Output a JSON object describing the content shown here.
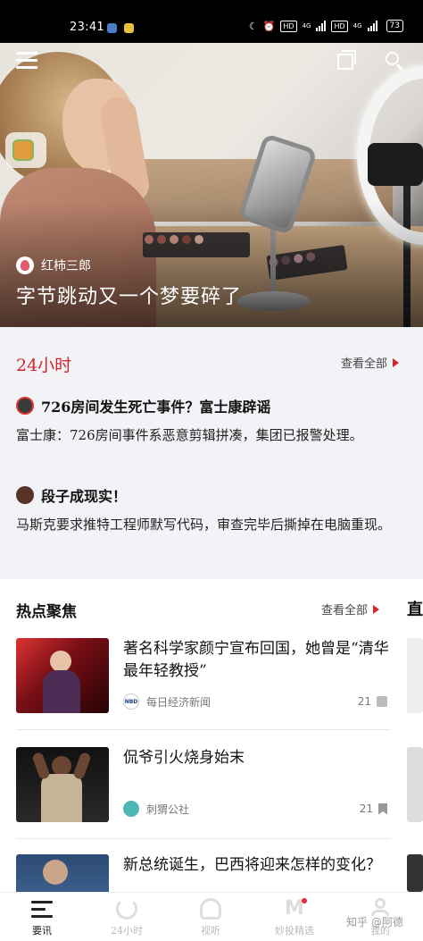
{
  "status_bar": {
    "time": "23:41",
    "network_labels": [
      "4G",
      "4G"
    ],
    "hd_labels": [
      "HD",
      "HD"
    ],
    "battery": "73"
  },
  "hero": {
    "author": "红柿三郎",
    "title": "字节跳动又一个梦要碎了"
  },
  "section_24h": {
    "title": "24小时",
    "see_all": "查看全部",
    "items": [
      {
        "headline": "726房间发生死亡事件？富士康辟谣",
        "summary": "富士康：726房间事件系恶意剪辑拼凑，集团已报警处理。"
      },
      {
        "headline": "段子成现实！",
        "summary": "马斯克要求推特工程师默写代码，审查完毕后撕掉在电脑重现。"
      }
    ]
  },
  "hot_focus": {
    "title": "热点聚焦",
    "see_all": "查看全部",
    "side_tab": "直",
    "items": [
      {
        "title": "著名科学家颜宁宣布回国，她曾是“清华最年轻教授”",
        "source": "每日经济新闻",
        "source_logo": "NBD",
        "count": "21"
      },
      {
        "title": "侃爷引火烧身始末",
        "source": "刺猬公社",
        "count": "21"
      },
      {
        "title": "新总统诞生，巴西将迎来怎样的变化？"
      }
    ]
  },
  "bottom_nav": {
    "items": [
      {
        "label": "要讯",
        "icon": "news-icon",
        "active": true
      },
      {
        "label": "24小时",
        "icon": "clock-icon",
        "active": false
      },
      {
        "label": "视听",
        "icon": "headphones-icon",
        "active": false
      },
      {
        "label": "妙投精选",
        "icon": "m-logo-icon",
        "active": false
      },
      {
        "label": "我的",
        "icon": "user-icon",
        "active": false
      }
    ],
    "watermark": "知乎 @阿德"
  },
  "colors": {
    "accent_red": "#d3252b",
    "section_bg": "#f2f3f7"
  }
}
